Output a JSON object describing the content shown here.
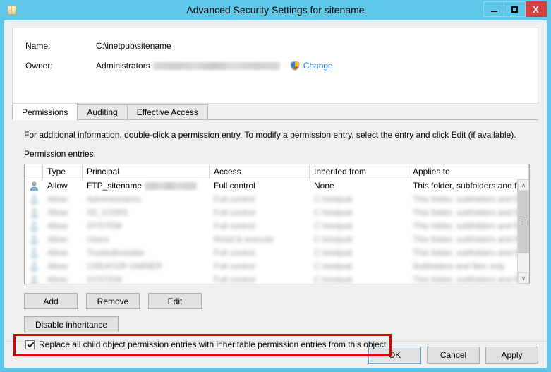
{
  "window": {
    "title": "Advanced Security Settings for sitename",
    "icon": "folder-icon",
    "controls": {
      "minimize": "minimize-button",
      "maximize": "maximize-button",
      "close_label": "X"
    }
  },
  "header": {
    "name_label": "Name:",
    "name_value": "C:\\inetpub\\sitename",
    "owner_label": "Owner:",
    "owner_value": "Administrators",
    "owner_redacted": true,
    "change_link": "Change",
    "change_icon": "uac-shield-icon"
  },
  "tabs": [
    {
      "label": "Permissions",
      "active": true
    },
    {
      "label": "Auditing",
      "active": false
    },
    {
      "label": "Effective Access",
      "active": false
    }
  ],
  "panel": {
    "note": "For additional information, double-click a permission entry. To modify a permission entry, select the entry and click Edit (if available).",
    "entries_label": "Permission entries:"
  },
  "listview": {
    "columns": [
      {
        "key": "icon",
        "label": ""
      },
      {
        "key": "type",
        "label": "Type"
      },
      {
        "key": "principal",
        "label": "Principal"
      },
      {
        "key": "access",
        "label": "Access"
      },
      {
        "key": "inherited",
        "label": "Inherited from"
      },
      {
        "key": "applies",
        "label": "Applies to"
      }
    ],
    "rows": [
      {
        "icon": "user-icon",
        "type": "Allow",
        "principal": "FTP_sitename",
        "principal_redacted": true,
        "access": "Full control",
        "inherited": "None",
        "applies": "This folder, subfolders and files",
        "blurred": false
      },
      {
        "icon": "user-icon",
        "type": "Allow",
        "principal": "Administrators",
        "principal_redacted": true,
        "access": "Full control",
        "inherited": "C:\\inetpub",
        "applies": "This folder, subfolders and files",
        "blurred": true
      },
      {
        "icon": "user-icon",
        "type": "Allow",
        "principal": "IIS_IUSRS",
        "principal_redacted": true,
        "access": "Full control",
        "inherited": "C:\\inetpub",
        "applies": "This folder, subfolders and files",
        "blurred": true
      },
      {
        "icon": "user-icon",
        "type": "Allow",
        "principal": "SYSTEM",
        "principal_redacted": false,
        "access": "Full control",
        "inherited": "C:\\inetpub",
        "applies": "This folder, subfolders and files",
        "blurred": true
      },
      {
        "icon": "user-icon",
        "type": "Allow",
        "principal": "Users",
        "principal_redacted": true,
        "access": "Read & execute",
        "inherited": "C:\\inetpub",
        "applies": "This folder, subfolders and files",
        "blurred": true
      },
      {
        "icon": "user-icon",
        "type": "Allow",
        "principal": "TrustedInstaller",
        "principal_redacted": false,
        "access": "Full control",
        "inherited": "C:\\inetpub",
        "applies": "This folder, subfolders and files",
        "blurred": true
      },
      {
        "icon": "user-icon",
        "type": "Allow",
        "principal": "CREATOR OWNER",
        "principal_redacted": false,
        "access": "Full control",
        "inherited": "C:\\inetpub",
        "applies": "Subfolders and files only",
        "blurred": true
      },
      {
        "icon": "user-icon",
        "type": "Allow",
        "principal": "SYSTEM",
        "principal_redacted": false,
        "access": "Full control",
        "inherited": "C:\\inetpub",
        "applies": "This folder, subfolders and files",
        "blurred": true
      }
    ],
    "scrollbar": {
      "up_glyph": "∧",
      "down_glyph": "∨"
    }
  },
  "actions": {
    "add": "Add",
    "remove": "Remove",
    "edit": "Edit",
    "disable_inheritance": "Disable inheritance"
  },
  "replace_option": {
    "label": "Replace all child object permission entries with inheritable permission entries from this object",
    "checked": true,
    "highlight_color": "#e00000"
  },
  "footer": {
    "ok": "OK",
    "cancel": "Cancel",
    "apply": "Apply"
  },
  "colors": {
    "titlebar": "#5fc8e8",
    "close_button": "#cf4040",
    "link": "#1a6fc4",
    "dialog_bg": "#f0f0f0",
    "annotation": "#e00000"
  }
}
